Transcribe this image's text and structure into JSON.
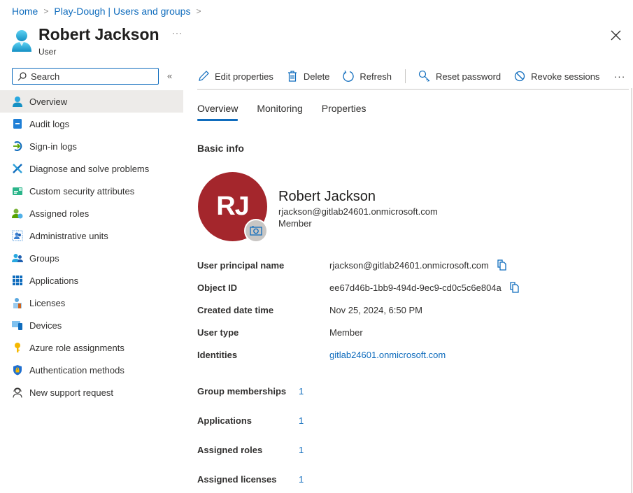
{
  "breadcrumb": [
    {
      "label": "Home"
    },
    {
      "label": "Play-Dough | Users and groups"
    }
  ],
  "header": {
    "title": "Robert Jackson",
    "subtitle": "User",
    "more_label": "···",
    "icon": "user-icon"
  },
  "search": {
    "placeholder": "Search",
    "value": ""
  },
  "collapse_label": "«",
  "sidebar": {
    "items": [
      {
        "label": "Overview",
        "icon": "user-icon",
        "active": true
      },
      {
        "label": "Audit logs",
        "icon": "audit-log-icon"
      },
      {
        "label": "Sign-in logs",
        "icon": "sign-in-icon"
      },
      {
        "label": "Diagnose and solve problems",
        "icon": "wrench-icon"
      },
      {
        "label": "Custom security attributes",
        "icon": "security-attributes-icon"
      },
      {
        "label": "Assigned roles",
        "icon": "assigned-roles-icon"
      },
      {
        "label": "Administrative units",
        "icon": "admin-units-icon"
      },
      {
        "label": "Groups",
        "icon": "groups-icon"
      },
      {
        "label": "Applications",
        "icon": "applications-grid-icon"
      },
      {
        "label": "Licenses",
        "icon": "licenses-icon"
      },
      {
        "label": "Devices",
        "icon": "devices-icon"
      },
      {
        "label": "Azure role assignments",
        "icon": "key-icon"
      },
      {
        "label": "Authentication methods",
        "icon": "shield-lock-icon"
      },
      {
        "label": "New support request",
        "icon": "support-person-icon"
      }
    ]
  },
  "toolbar": {
    "edit_label": "Edit properties",
    "delete_label": "Delete",
    "refresh_label": "Refresh",
    "reset_password_label": "Reset password",
    "revoke_sessions_label": "Revoke sessions",
    "more_label": "···"
  },
  "tabs": [
    {
      "label": "Overview",
      "active": true
    },
    {
      "label": "Monitoring"
    },
    {
      "label": "Properties"
    }
  ],
  "basic_info": {
    "title": "Basic info",
    "avatar_initials": "RJ",
    "avatar_color": "#a4262c",
    "name": "Robert Jackson",
    "email": "rjackson@gitlab24601.onmicrosoft.com",
    "user_type": "Member"
  },
  "properties": [
    {
      "label": "User principal name",
      "value": "rjackson@gitlab24601.onmicrosoft.com",
      "copyable": true
    },
    {
      "label": "Object ID",
      "value": "ee67d46b-1bb9-494d-9ec9-cd0c5c6e804a",
      "copyable": true
    },
    {
      "label": "Created date time",
      "value": "Nov 25, 2024, 6:50 PM"
    },
    {
      "label": "User type",
      "value": "Member"
    },
    {
      "label": "Identities",
      "value": "gitlab24601.onmicrosoft.com",
      "link": true
    }
  ],
  "counts": [
    {
      "label": "Group memberships",
      "value": "1"
    },
    {
      "label": "Applications",
      "value": "1"
    },
    {
      "label": "Assigned roles",
      "value": "1"
    },
    {
      "label": "Assigned licenses",
      "value": "1"
    }
  ],
  "colors": {
    "accent": "#0f6cbd",
    "active_nav_bg": "#edebe9"
  }
}
